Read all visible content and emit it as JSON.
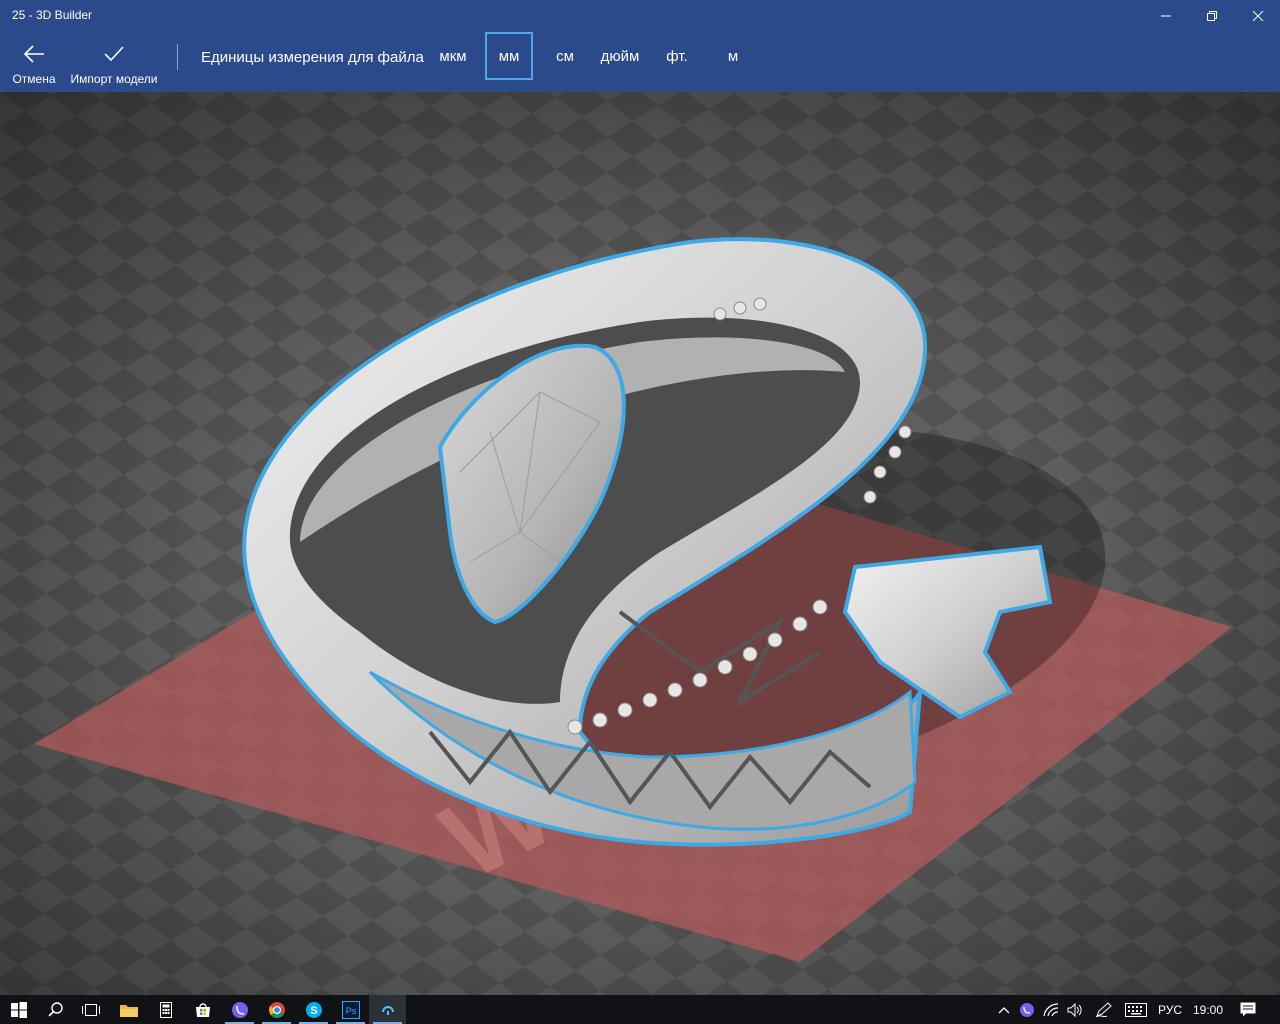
{
  "window": {
    "title": "25 - 3D Builder"
  },
  "toolbar": {
    "cancel_label": "Отмена",
    "import_label": "Импорт модели",
    "units_label": "Единицы измерения для файла",
    "units": [
      "мкм",
      "мм",
      "см",
      "дюйм",
      "фт.",
      "м"
    ],
    "selected_unit": "мм"
  },
  "viewport": {
    "platform_text": "W",
    "selection_color": "#3fa9e6",
    "platform_color": "#b65a5a"
  },
  "taskbar": {
    "apps": [
      "start-icon",
      "search-icon",
      "task-view-icon",
      "file-explorer-icon",
      "calculator-icon",
      "store-icon",
      "viber-icon",
      "chrome-icon",
      "skype-icon",
      "photoshop-icon",
      "3d-builder-icon"
    ],
    "language": "РУС",
    "time": "19:00"
  },
  "colors": {
    "accent": "#2b4a8b",
    "selection": "#3fa9e6",
    "taskbar": "#101216"
  }
}
